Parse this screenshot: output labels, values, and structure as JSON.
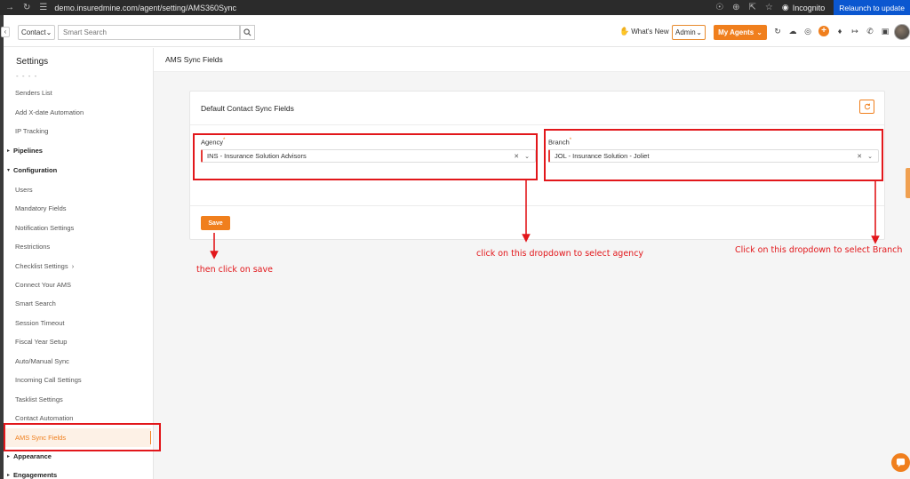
{
  "browser": {
    "url": "demo.insuredmine.com/agent/setting/AMS360Sync",
    "incognito_label": "Incognito",
    "relaunch_label": "Relaunch to update"
  },
  "header": {
    "contact_select": "Contact",
    "search_placeholder": "Smart Search",
    "whats_new": "What's New",
    "admin_select": "Admin",
    "agents_button": "My Agents"
  },
  "sidebar": {
    "title": "Settings",
    "items": {
      "senders_list": "Senders List",
      "add_xdate": "Add X-date Automation",
      "ip_tracking": "IP Tracking",
      "pipelines": "Pipelines",
      "configuration": "Configuration",
      "users": "Users",
      "mandatory_fields": "Mandatory Fields",
      "notification_settings": "Notification Settings",
      "restrictions": "Restrictions",
      "checklist_settings": "Checklist Settings",
      "connect_ams": "Connect Your AMS",
      "smart_search": "Smart Search",
      "session_timeout": "Session Timeout",
      "fiscal_year": "Fiscal Year Setup",
      "auto_manual_sync": "Auto/Manual Sync",
      "incoming_call": "Incoming Call Settings",
      "tasklist_settings": "Tasklist Settings",
      "contact_automation": "Contact Automation",
      "ams_sync_fields": "AMS Sync Fields",
      "appearance": "Appearance",
      "engagements": "Engagements"
    }
  },
  "main": {
    "page_title": "AMS Sync Fields",
    "card_title": "Default Contact Sync Fields",
    "agency_label": "Agency",
    "agency_value": "INS - Insurance Solution Advisors",
    "branch_label": "Branch",
    "branch_value": "JOL - Insurance Solution - Joliet",
    "required_mark": "*",
    "save_label": "Save"
  },
  "annotations": {
    "save_note": "then click on save",
    "agency_note": "click on this dropdown to select agency",
    "branch_note": "Click on this dropdown to select Branch"
  },
  "colors": {
    "accent": "#f07f1d",
    "annotation_red": "#e2171b"
  }
}
